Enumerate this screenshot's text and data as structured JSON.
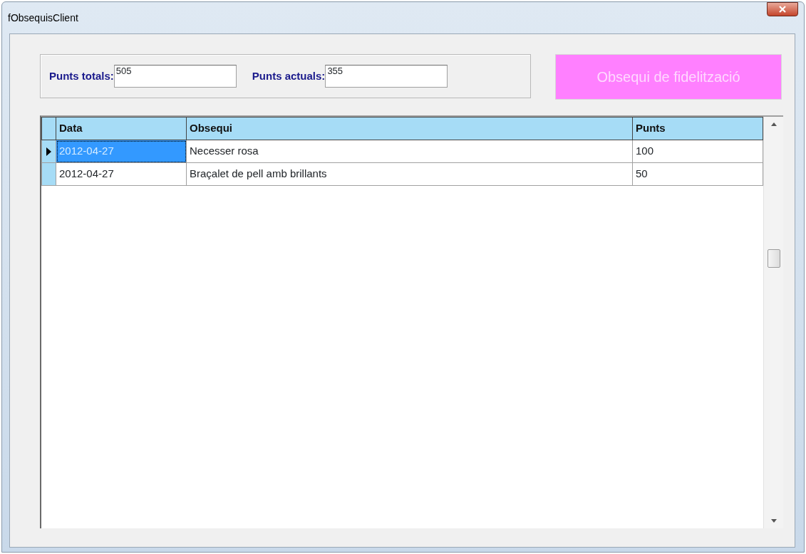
{
  "window": {
    "title": "fObsequisClient"
  },
  "points": [
    {
      "label": "Punts totals:",
      "value": "505"
    },
    {
      "label": "Punts actuals:",
      "value": "355"
    }
  ],
  "gift_button": {
    "label": "Obsequi de fidelització"
  },
  "table": {
    "columns": [
      "Data",
      "Obsequi",
      "Punts"
    ],
    "rows": [
      {
        "cells": [
          "2012-04-27",
          "Necesser rosa",
          "100"
        ],
        "selected": true
      },
      {
        "cells": [
          "2012-04-27",
          "Braçalet de pell amb brillants",
          "50"
        ],
        "selected": false
      }
    ]
  }
}
